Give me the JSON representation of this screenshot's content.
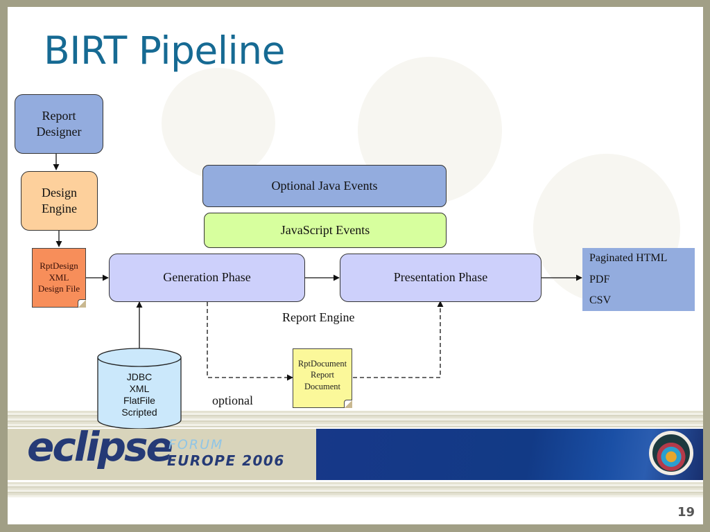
{
  "slide": {
    "title": "BIRT Pipeline",
    "page_number": "19"
  },
  "nodes": {
    "report_designer": [
      "Report",
      "Designer"
    ],
    "design_engine": [
      "Design",
      "Engine"
    ],
    "rptdesign_file": [
      "RptDesign",
      "XML",
      "Design File"
    ],
    "optional_java_events": "Optional Java Events",
    "javascript_events": "JavaScript Events",
    "generation_phase": "Generation Phase",
    "presentation_phase": "Presentation Phase",
    "report_engine_label": "Report Engine",
    "data_sources": [
      "JDBC",
      "XML",
      "FlatFile",
      "Scripted"
    ],
    "rptdocument": [
      "RptDocument",
      "Report",
      "Document"
    ],
    "optional_label": "optional",
    "outputs": [
      "Paginated HTML",
      "PDF",
      "CSV"
    ]
  },
  "footer": {
    "brand": "eclipse",
    "forum": "FORUM",
    "event": "EUROPE 2006"
  },
  "colors": {
    "title": "#166a93",
    "report_designer": "#93acde",
    "design_engine": "#fdd09c",
    "rptdesign_file": "#f78e5a",
    "optional_java_events": "#93acde",
    "javascript_events": "#d7ff9e",
    "phase": "#cdd0fb",
    "data_sources": "#cbe8fb",
    "rptdocument": "#fbf89a",
    "outputs": "#93acde"
  }
}
